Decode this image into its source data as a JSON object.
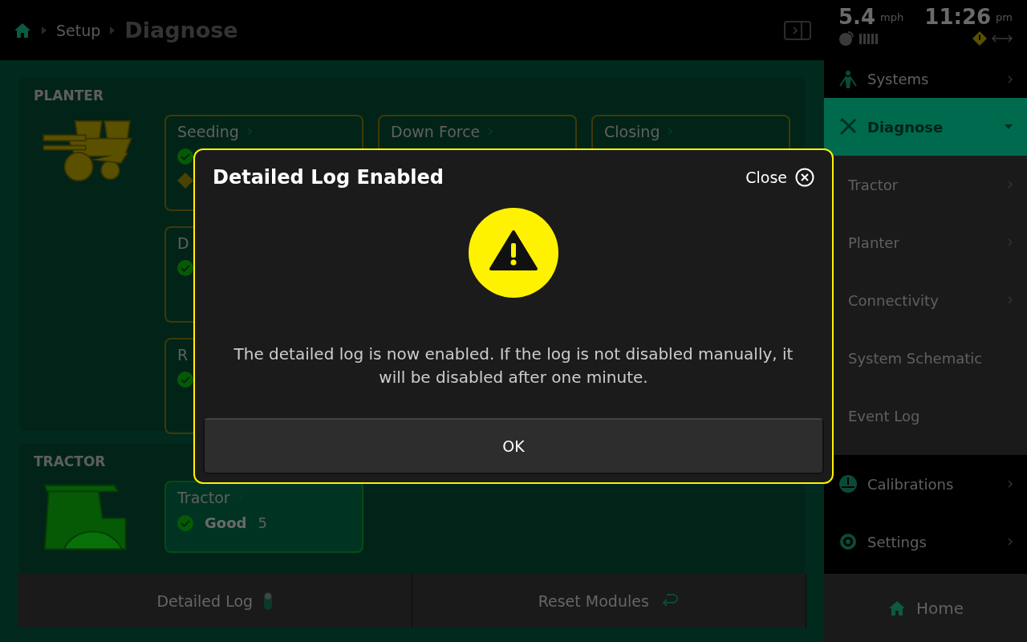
{
  "breadcrumb": {
    "items": [
      "Setup"
    ],
    "current": "Diagnose"
  },
  "sections": [
    {
      "title": "PLANTER",
      "card_columns": [
        [
          {
            "title": "Seeding",
            "statuses": [
              {
                "kind": "good"
              },
              {
                "kind": "warning"
              }
            ]
          },
          {
            "title": "D",
            "statuses": [
              {
                "kind": "good"
              }
            ]
          },
          {
            "title": "R",
            "statuses": [
              {
                "kind": "good"
              }
            ]
          }
        ],
        [
          {
            "title": "Down Force"
          }
        ],
        [
          {
            "title": "Closing"
          }
        ]
      ]
    },
    {
      "title": "TRACTOR",
      "card_columns": [
        [
          {
            "title": "Tractor",
            "statuses": [
              {
                "kind": "good",
                "label": "Good",
                "count": "5"
              }
            ]
          }
        ]
      ]
    }
  ],
  "actions": [
    {
      "label": "Detailed Log",
      "kind": "toggle"
    },
    {
      "label": "Reset Modules",
      "kind": "reset"
    }
  ],
  "status": {
    "speed": "5.4",
    "speed_unit": "mph",
    "time": "11:26",
    "time_suffix": "pm"
  },
  "sidebar": {
    "items": [
      {
        "label": "Systems",
        "kind": "main",
        "selected": false,
        "expanded": false,
        "chevron": true
      },
      {
        "label": "Diagnose",
        "kind": "main",
        "selected": true,
        "expanded": true,
        "chevron": true
      },
      {
        "label": "Tractor",
        "kind": "sub",
        "selected": false,
        "expanded": false,
        "chevron": true
      },
      {
        "label": "Planter",
        "kind": "sub",
        "selected": false,
        "expanded": false,
        "chevron": true
      },
      {
        "label": "Connectivity",
        "kind": "sub",
        "selected": false,
        "expanded": false,
        "chevron": true
      },
      {
        "label": "System Schematic",
        "kind": "sub",
        "selected": false,
        "expanded": false,
        "chevron": false
      },
      {
        "label": "Event Log",
        "kind": "sub",
        "selected": false,
        "expanded": false,
        "chevron": false
      },
      {
        "label": "Calibrations",
        "kind": "main",
        "selected": false,
        "expanded": false,
        "chevron": true
      },
      {
        "label": "Settings",
        "kind": "main",
        "selected": false,
        "expanded": false,
        "chevron": true
      }
    ],
    "home": "Home"
  },
  "dialog": {
    "title": "Detailed Log Enabled",
    "close": "Close",
    "message": "The detailed log is now enabled. If the log is not disabled manually, it will be disabled after one minute.",
    "button": "OK"
  }
}
